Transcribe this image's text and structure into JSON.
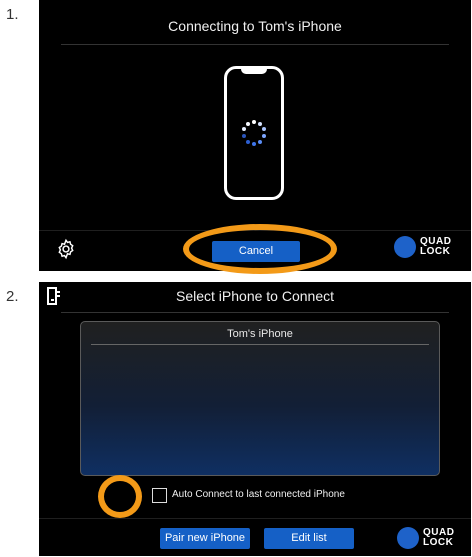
{
  "step1": {
    "number": "1.",
    "title": "Connecting to Tom's iPhone",
    "cancel_label": "Cancel",
    "settings_icon": "gear-icon"
  },
  "step2": {
    "number": "2.",
    "title": "Select iPhone to Connect",
    "list": [
      "Tom's iPhone"
    ],
    "auto_connect_label": "Auto Connect to last connected iPhone",
    "auto_connect_checked": false,
    "pair_label": "Pair new iPhone",
    "edit_label": "Edit list",
    "exit_icon": "exit-door-icon"
  },
  "logo": {
    "line1": "QUAD",
    "line2": "LOCK"
  },
  "colors": {
    "accent_blue": "#1560c6",
    "highlight_orange": "#f39a18",
    "screen_bg": "#000000"
  }
}
